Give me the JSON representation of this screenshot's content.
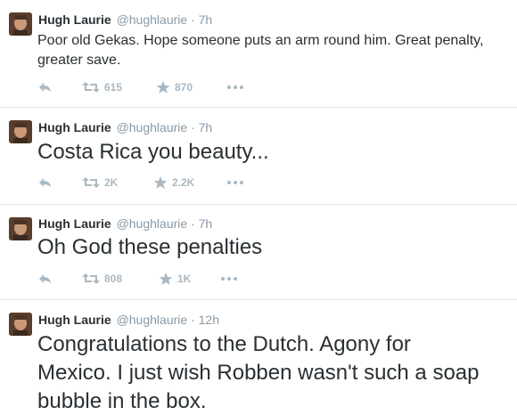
{
  "tweets": [
    {
      "fullname": "Hugh Laurie",
      "username": "@hughlaurie",
      "separator": "·",
      "time": "7h",
      "text": "Poor old Gekas. Hope someone puts an arm round him. Great penalty, greater save.",
      "retweets": "615",
      "favorites": "870"
    },
    {
      "fullname": "Hugh Laurie",
      "username": "@hughlaurie",
      "separator": "·",
      "time": "7h",
      "text": "Costa Rica you beauty...",
      "retweets": "2K",
      "favorites": "2.2K"
    },
    {
      "fullname": "Hugh Laurie",
      "username": "@hughlaurie",
      "separator": "·",
      "time": "7h",
      "text": "Oh God these penalties",
      "retweets": "808",
      "favorites": "1K"
    },
    {
      "fullname": "Hugh Laurie",
      "username": "@hughlaurie",
      "separator": "·",
      "time": "12h",
      "text": "Congratulations to the Dutch. Agony for Mexico. I just wish Robben wasn't such a soap bubble in the box."
    }
  ],
  "icons": {
    "reply": "reply-icon",
    "retweet": "retweet-icon",
    "favorite": "star-icon",
    "more": "more-icon"
  },
  "colors": {
    "text": "#292f33",
    "muted": "#8899a6",
    "action": "#aab8c2",
    "divider": "#e1e8ed"
  }
}
